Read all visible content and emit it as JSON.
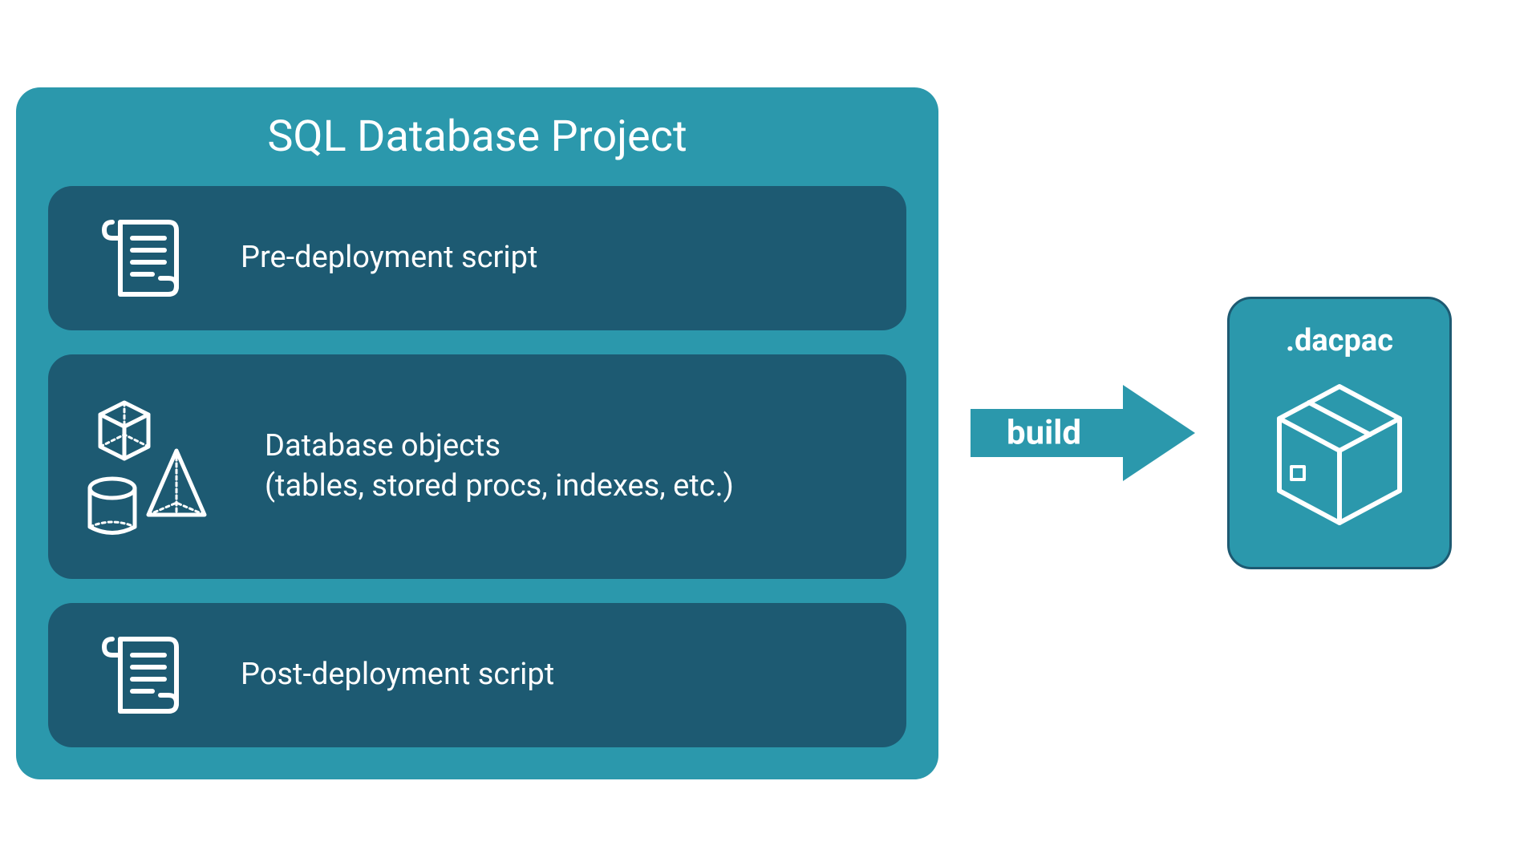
{
  "project": {
    "title": "SQL Database Project",
    "items": [
      {
        "label": "Pre-deployment script",
        "icon": "scroll"
      },
      {
        "label": "Database objects\n(tables, stored procs, indexes, etc.)",
        "icon": "shapes"
      },
      {
        "label": "Post-deployment script",
        "icon": "scroll"
      }
    ]
  },
  "arrow": {
    "label": "build"
  },
  "output": {
    "title": ".dacpac",
    "icon": "package"
  },
  "colors": {
    "container": "#2b98ac",
    "item": "#1d5a72",
    "text": "#ffffff"
  }
}
